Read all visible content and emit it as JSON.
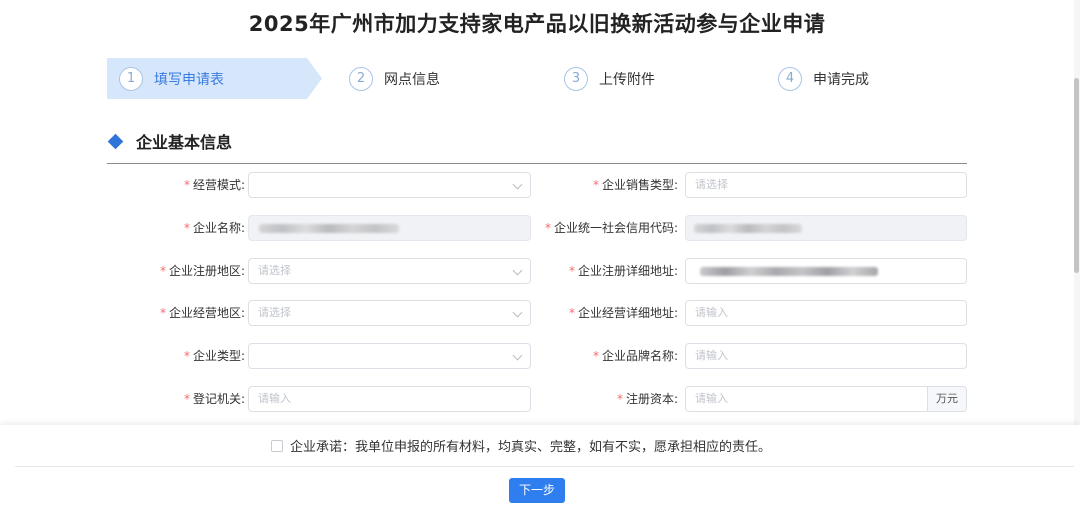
{
  "page": {
    "title": "2025年广州市加力支持家电产品以旧换新活动参与企业申请"
  },
  "steps": [
    {
      "number": "1",
      "label": "填写申请表",
      "active": true
    },
    {
      "number": "2",
      "label": "网点信息",
      "active": false
    },
    {
      "number": "3",
      "label": "上传附件",
      "active": false
    },
    {
      "number": "4",
      "label": "申请完成",
      "active": false
    }
  ],
  "section": {
    "title": "企业基本信息"
  },
  "required_mark": "*",
  "form": {
    "business_mode": {
      "label": "经营模式:",
      "value": ""
    },
    "sales_type": {
      "label": "企业销售类型:",
      "placeholder": "请选择"
    },
    "company_name": {
      "label": "企业名称:",
      "value_state": "redacted"
    },
    "credit_code": {
      "label": "企业统一社会信用代码:",
      "value_state": "redacted"
    },
    "reg_region": {
      "label": "企业注册地区:",
      "placeholder": "请选择"
    },
    "reg_address": {
      "label": "企业注册详细地址:",
      "value_state": "redacted"
    },
    "op_region": {
      "label": "企业经营地区:",
      "placeholder": "请选择"
    },
    "op_address": {
      "label": "企业经营详细地址:",
      "placeholder": "请输入"
    },
    "company_type": {
      "label": "企业类型:",
      "value": ""
    },
    "brand_name": {
      "label": "企业品牌名称:",
      "placeholder": "请输入"
    },
    "reg_authority": {
      "label": "登记机关:",
      "placeholder": "请输入"
    },
    "reg_capital": {
      "label": "注册资本:",
      "placeholder": "请输入",
      "suffix": "万元"
    }
  },
  "footer": {
    "pledge": "企业承诺：我单位申报的所有材料，均真实、完整，如有不实，愿承担相应的责任。",
    "pledge_checked": false,
    "next_label": "下一步"
  },
  "colors": {
    "accent": "#2f7ef0",
    "active_step_bg": "#d7e7fb",
    "required": "#f56c6c"
  }
}
